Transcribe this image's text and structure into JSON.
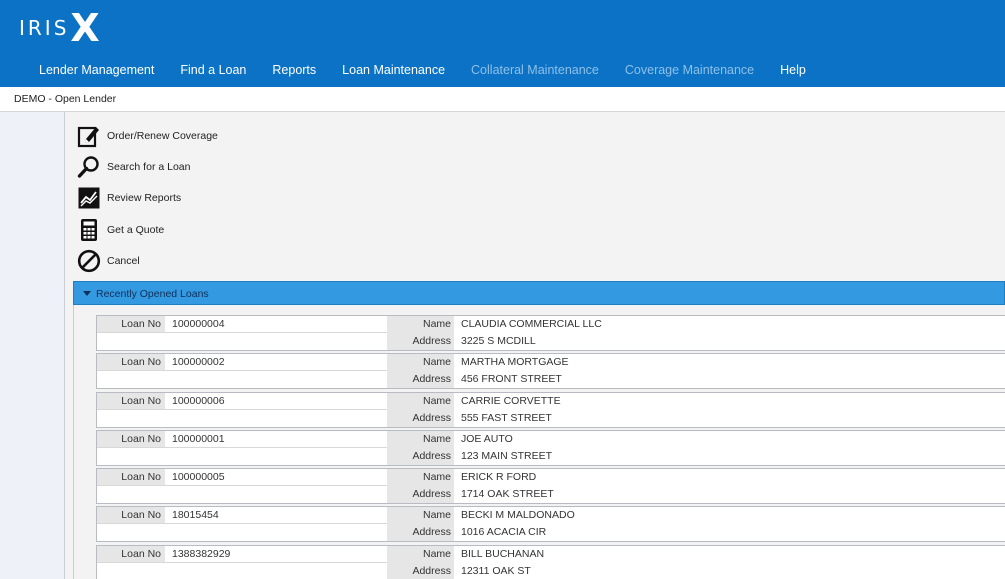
{
  "header": {
    "logo_text": "IRIS",
    "logo_mark": "X",
    "nav": [
      {
        "label": "Lender Management",
        "enabled": true
      },
      {
        "label": "Find a Loan",
        "enabled": true
      },
      {
        "label": "Reports",
        "enabled": true
      },
      {
        "label": "Loan Maintenance",
        "enabled": true
      },
      {
        "label": "Collateral Maintenance",
        "enabled": false
      },
      {
        "label": "Coverage Maintenance",
        "enabled": false
      },
      {
        "label": "Help",
        "enabled": true
      }
    ]
  },
  "breadcrumb": "DEMO - Open Lender",
  "actions": [
    {
      "label": "Order/Renew Coverage",
      "icon": "edit-icon"
    },
    {
      "label": "Search for a Loan",
      "icon": "search-icon"
    },
    {
      "label": "Review Reports",
      "icon": "chart-icon"
    },
    {
      "label": "Get a Quote",
      "icon": "calculator-icon"
    },
    {
      "label": "Cancel",
      "icon": "cancel-icon"
    }
  ],
  "recent": {
    "title": "Recently Opened Loans",
    "labels": {
      "loan_no": "Loan No",
      "name": "Name",
      "address": "Address"
    },
    "loans": [
      {
        "loan_no": "100000004",
        "name": "CLAUDIA COMMERCIAL LLC",
        "address": "3225 S MCDILL"
      },
      {
        "loan_no": "100000002",
        "name": "MARTHA MORTGAGE",
        "address": "456 FRONT STREET"
      },
      {
        "loan_no": "100000006",
        "name": "CARRIE CORVETTE",
        "address": "555 FAST STREET"
      },
      {
        "loan_no": "100000001",
        "name": "JOE AUTO",
        "address": "123 MAIN STREET"
      },
      {
        "loan_no": "100000005",
        "name": "ERICK R FORD",
        "address": "1714 OAK STREET"
      },
      {
        "loan_no": "18015454",
        "name": "BECKI M MALDONADO",
        "address": "1016 ACACIA CIR"
      },
      {
        "loan_no": "1388382929",
        "name": "BILL BUCHANAN",
        "address": "12311 OAK ST"
      }
    ]
  },
  "colors": {
    "header": "#0b72c6",
    "accordion": "#3399e0",
    "disabled_nav": "#8fc0e8"
  }
}
